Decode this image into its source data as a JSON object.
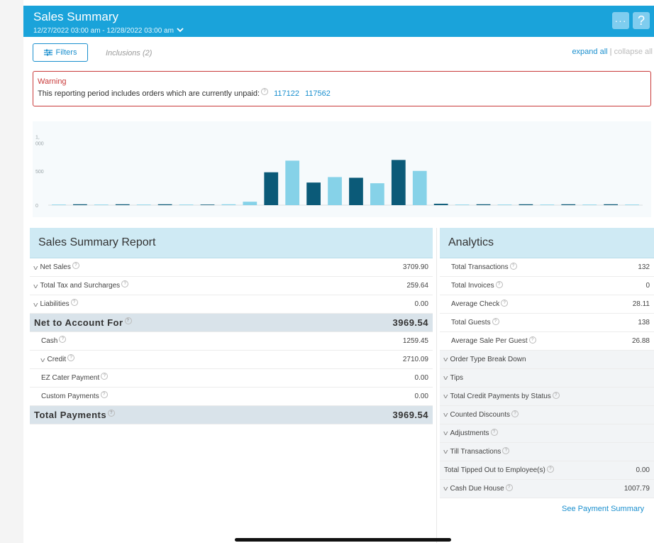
{
  "header": {
    "title": "Sales Summary",
    "date_range": "12/27/2022 03:00 am - 12/28/2022 03:00 am",
    "more_label": "···",
    "help_label": "?"
  },
  "toolbar": {
    "filters_label": "Filters",
    "inclusions": "Inclusions (2)",
    "expand_all": "expand all",
    "separator": "|",
    "collapse_all": "collapse all"
  },
  "warning": {
    "title": "Warning",
    "message": "This reporting period includes orders which are currently unpaid:",
    "orders": [
      "117122",
      "117562"
    ]
  },
  "chart_data": {
    "type": "bar",
    "y_tick_labels": [
      "1,\n000",
      "500",
      "0"
    ],
    "yticks": [
      1000,
      500,
      0
    ],
    "ylim": [
      0,
      1120
    ],
    "grid": false,
    "colors": {
      "dark": "#0b5a78",
      "light": "#86d2e8"
    },
    "values": [
      0,
      5,
      0,
      5,
      0,
      5,
      0,
      0,
      5,
      50,
      480,
      650,
      330,
      410,
      400,
      320,
      660,
      500,
      20,
      0,
      5,
      0,
      5,
      0,
      5,
      0,
      5,
      0
    ],
    "shades": [
      "light",
      "dark",
      "light",
      "dark",
      "light",
      "dark",
      "light",
      "dark",
      "light",
      "light",
      "dark",
      "light",
      "dark",
      "light",
      "dark",
      "light",
      "dark",
      "light",
      "dark",
      "light",
      "dark",
      "light",
      "dark",
      "light",
      "dark",
      "light",
      "dark",
      "light"
    ]
  },
  "summary": {
    "title": "Sales Summary Report",
    "rows": [
      {
        "label": "Net Sales",
        "value": "3709.90"
      },
      {
        "label": "Total Tax and Surcharges",
        "value": "259.64"
      },
      {
        "label": "Liabilities",
        "value": "0.00"
      },
      {
        "label": "Net to Account For",
        "value": "3969.54"
      },
      {
        "label": "Cash",
        "value": "1259.45"
      },
      {
        "label": "Credit",
        "value": "2710.09"
      },
      {
        "label": "EZ Cater Payment",
        "value": "0.00"
      },
      {
        "label": "Custom Payments",
        "value": "0.00"
      },
      {
        "label": "Total Payments",
        "value": "3969.54"
      }
    ]
  },
  "analytics": {
    "title": "Analytics",
    "rows": [
      {
        "label": "Total Transactions",
        "value": "132"
      },
      {
        "label": "Total Invoices",
        "value": "0"
      },
      {
        "label": "Average Check",
        "value": "28.11"
      },
      {
        "label": "Total Guests",
        "value": "138"
      },
      {
        "label": "Average Sale Per Guest",
        "value": "26.88"
      },
      {
        "label": "Order Type Break Down",
        "value": ""
      },
      {
        "label": "Tips",
        "value": ""
      },
      {
        "label": "Total Credit Payments by Status",
        "value": ""
      },
      {
        "label": "Counted Discounts",
        "value": ""
      },
      {
        "label": "Adjustments",
        "value": ""
      },
      {
        "label": "Till Transactions",
        "value": ""
      },
      {
        "label": "Total Tipped Out to Employee(s)",
        "value": "0.00"
      },
      {
        "label": "Cash Due House",
        "value": "1007.79"
      }
    ],
    "see_payment": "See Payment Summary"
  }
}
